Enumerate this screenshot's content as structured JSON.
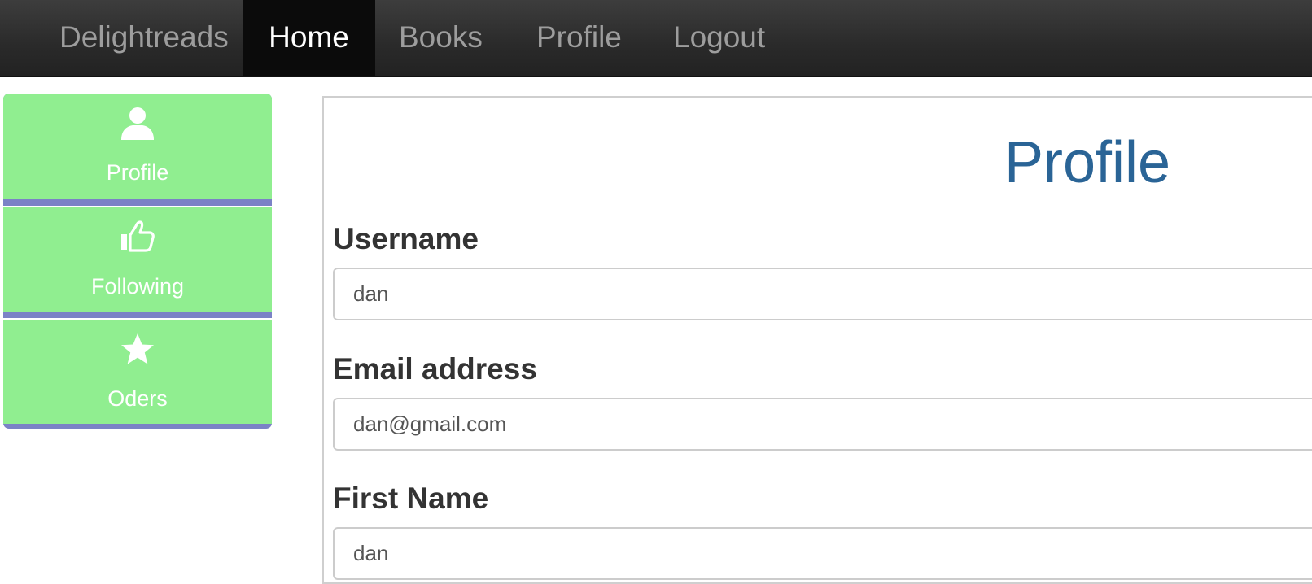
{
  "navbar": {
    "brand": "Delightreads",
    "items": [
      {
        "label": "Home",
        "active": true
      },
      {
        "label": "Books",
        "active": false
      },
      {
        "label": "Profile",
        "active": false
      },
      {
        "label": "Logout",
        "active": false
      }
    ]
  },
  "sidebar": {
    "items": [
      {
        "label": "Profile",
        "icon": "user-icon"
      },
      {
        "label": "Following",
        "icon": "thumbs-up-icon"
      },
      {
        "label": "Oders",
        "icon": "star-icon"
      }
    ]
  },
  "main": {
    "title": "Profile",
    "fields": [
      {
        "label": "Username",
        "value": "dan"
      },
      {
        "label": "Email address",
        "value": "dan@gmail.com"
      },
      {
        "label": "First Name",
        "value": "dan"
      }
    ]
  },
  "colors": {
    "navbar_bg": "#2a2a2a",
    "nav_active_bg": "#0b0b0b",
    "sidebar_item_bg": "#90ee90",
    "sidebar_divider": "#7b82c6",
    "title_color": "#2a6496"
  }
}
